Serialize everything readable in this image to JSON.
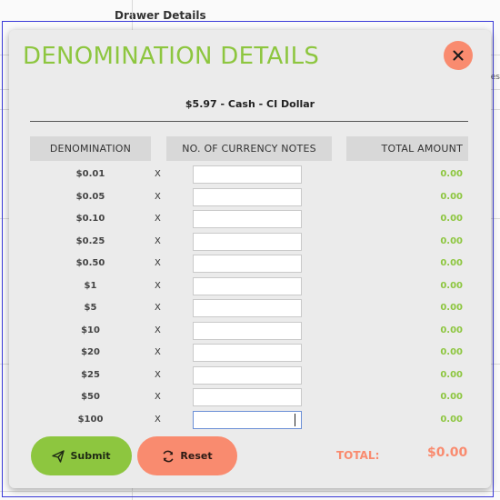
{
  "background": {
    "title": "Drawer Details",
    "edge_text": "es"
  },
  "modal": {
    "title": "DENOMINATION DETAILS",
    "close_icon": "close-icon",
    "subtitle": "$5.97 - Cash - CI Dollar",
    "columns": {
      "denomination": "DENOMINATION",
      "notes": "NO. OF CURRENCY NOTES",
      "total": "TOTAL AMOUNT"
    },
    "multiplier_symbol": "X",
    "rows": [
      {
        "denomination": "$0.01",
        "count": "",
        "amount": "0.00"
      },
      {
        "denomination": "$0.05",
        "count": "",
        "amount": "0.00"
      },
      {
        "denomination": "$0.10",
        "count": "",
        "amount": "0.00"
      },
      {
        "denomination": "$0.25",
        "count": "",
        "amount": "0.00"
      },
      {
        "denomination": "$0.50",
        "count": "",
        "amount": "0.00"
      },
      {
        "denomination": "$1",
        "count": "",
        "amount": "0.00"
      },
      {
        "denomination": "$5",
        "count": "",
        "amount": "0.00"
      },
      {
        "denomination": "$10",
        "count": "",
        "amount": "0.00"
      },
      {
        "denomination": "$20",
        "count": "",
        "amount": "0.00"
      },
      {
        "denomination": "$25",
        "count": "",
        "amount": "0.00"
      },
      {
        "denomination": "$50",
        "count": "",
        "amount": "0.00"
      },
      {
        "denomination": "$100",
        "count": "",
        "amount": "0.00"
      }
    ],
    "submit_label": "Submit",
    "reset_label": "Reset",
    "total_label": "TOTAL:",
    "total_value": "$0.00"
  },
  "colors": {
    "accent_green": "#8dc63f",
    "accent_salmon": "#f98b6f",
    "modal_bg": "#ebebeb",
    "header_bg": "#d8d8d8"
  },
  "icons": {
    "submit": "paper-plane-icon",
    "reset": "refresh-icon"
  }
}
